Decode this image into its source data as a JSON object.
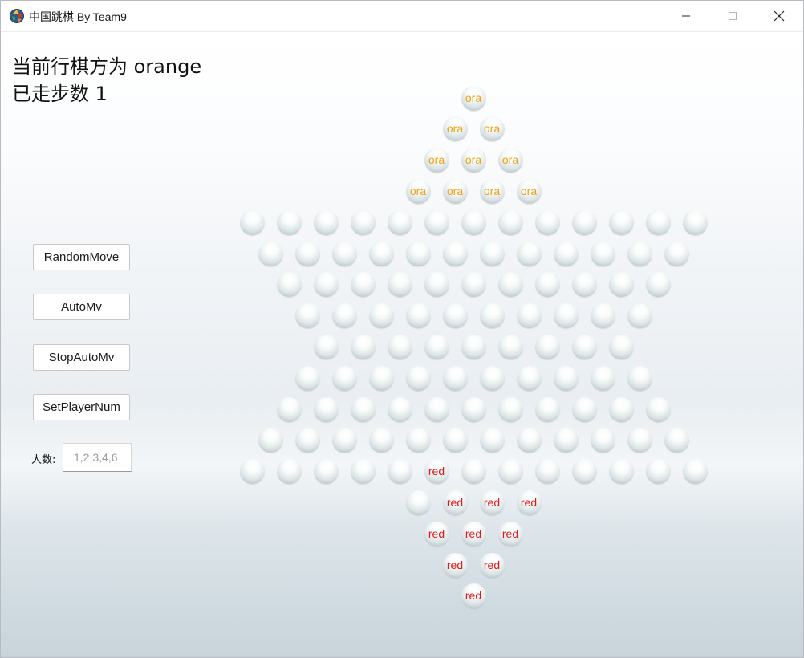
{
  "window": {
    "title": "中国跳棋 By Team9"
  },
  "status": {
    "current_player_text": "当前行棋方为 orange",
    "steps_text": "已走步数 1"
  },
  "controls": {
    "random_move_label": "RandomMove",
    "auto_move_label": "AutoMv",
    "stop_auto_move_label": "StopAutoMv",
    "set_player_num_label": "SetPlayerNum",
    "player_count_label": "人数:",
    "player_count_placeholder": "1,2,3,4,6",
    "player_count_value": ""
  },
  "board": {
    "orange_label": "ora",
    "red_label": "red",
    "rows": [
      {
        "count": 1,
        "pieces": {
          "0": "orange"
        }
      },
      {
        "count": 2,
        "pieces": {
          "0": "orange",
          "1": "orange"
        }
      },
      {
        "count": 3,
        "pieces": {
          "0": "orange",
          "1": "orange",
          "2": "orange"
        }
      },
      {
        "count": 4,
        "pieces": {
          "0": "orange",
          "1": "orange",
          "2": "orange",
          "3": "orange"
        }
      },
      {
        "count": 13,
        "pieces": {}
      },
      {
        "count": 12,
        "pieces": {}
      },
      {
        "count": 11,
        "pieces": {}
      },
      {
        "count": 10,
        "pieces": {}
      },
      {
        "count": 9,
        "pieces": {}
      },
      {
        "count": 10,
        "pieces": {}
      },
      {
        "count": 11,
        "pieces": {}
      },
      {
        "count": 12,
        "pieces": {}
      },
      {
        "count": 13,
        "pieces": {
          "5": "red"
        }
      },
      {
        "count": 4,
        "pieces": {
          "1": "red",
          "2": "red",
          "3": "red"
        }
      },
      {
        "count": 3,
        "pieces": {
          "0": "red",
          "1": "red",
          "2": "red"
        }
      },
      {
        "count": 2,
        "pieces": {
          "0": "red",
          "1": "red"
        }
      },
      {
        "count": 1,
        "pieces": {
          "0": "red"
        }
      }
    ]
  }
}
